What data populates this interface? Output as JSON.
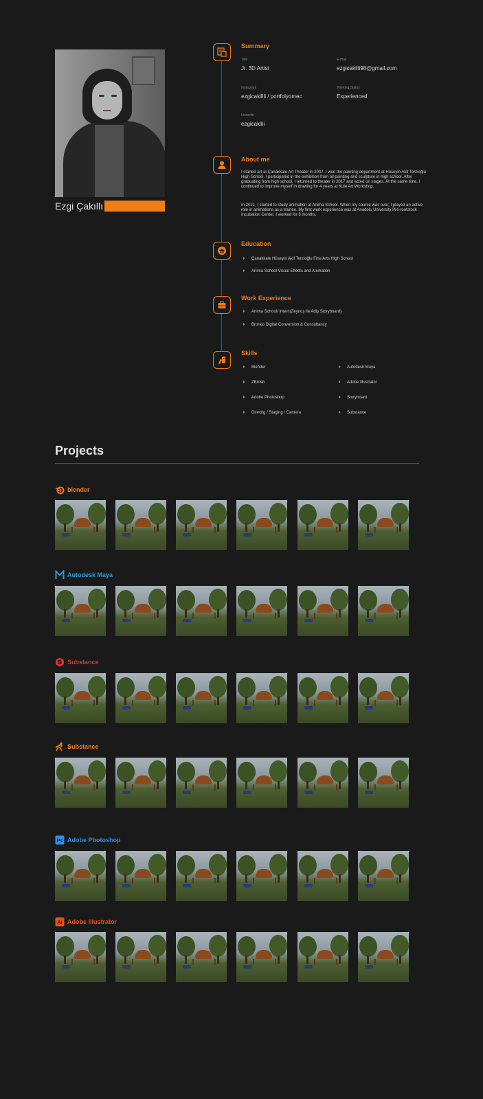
{
  "profile": {
    "name": "Ezgi Çakıllı"
  },
  "summary": {
    "heading": "Summary",
    "title_label": "Title",
    "title_value": "Jr. 3D Artist",
    "email_label": "E-mail",
    "email_value": "ezgicakilli98@gmail.com",
    "instagram_label": "Instagram",
    "instagram_value": "ezgicakillli / portfolyomec",
    "status_label": "Working Status",
    "status_value": "Experienced",
    "linkedin_label": "Linkedin",
    "linkedin_value": "ezgicakilli"
  },
  "about": {
    "heading": "About me",
    "p1": "I started art at Çanakkale Art Theater in 2007. I won the painting department at Hüseyin Akif Terzioğlu High School. I participated in the exhibition from oil painting and sculpture in high school. After graduating from high school, I returned to theater in 2017 and acted on stages. At the same time, I continued to improve myself in drawing for 4 years at Kule Art Workshop.",
    "p2": "In 2021, I started to study animation at Anima School. When my course was over, I played an active role in animations as a trainee. My first work experience was at Anadolu University Pre-rootstock Incubation Center. I worked for 8 months."
  },
  "education": {
    "heading": "Education",
    "items": [
      "Çanakkale Hüseyin Akif Terzioğlu Fine Arts High School",
      "Anima School Visual Effects and Animation"
    ]
  },
  "work": {
    "heading": "Work Experience",
    "items": [
      "Anima School/ Intern(Zeynoş ile Adiş Storyboard)",
      "Bronco Digital Conversion & Consultancy"
    ]
  },
  "skills": {
    "heading": "Skills",
    "items": [
      "Blender",
      "Autodesk Maya",
      "ZBrush",
      "Adobe Illustrator",
      "Adobe Photoshop",
      "Storyboard",
      "Directig / Staging / Camera",
      "Substance"
    ]
  },
  "projects": {
    "heading": "Projects",
    "groups": [
      {
        "label": "blender",
        "color": "#f07d14",
        "icon": "blender-icon"
      },
      {
        "label": "Autodesk Maya",
        "color": "#2a9bd6",
        "icon": "maya-icon"
      },
      {
        "label": "Substance",
        "color": "#e0332f",
        "icon": "substance-icon"
      },
      {
        "label": "Substance",
        "color": "#f07d14",
        "icon": "zbrush-icon"
      },
      {
        "label": "Adobe Photoshop",
        "color": "#2f8fe8",
        "icon": "photoshop-icon"
      },
      {
        "label": "Adobe Illustrator",
        "color": "#e8501a",
        "icon": "illustrator-icon"
      }
    ]
  },
  "colors": {
    "accent": "#f07d14",
    "background": "#1a1a1a"
  }
}
